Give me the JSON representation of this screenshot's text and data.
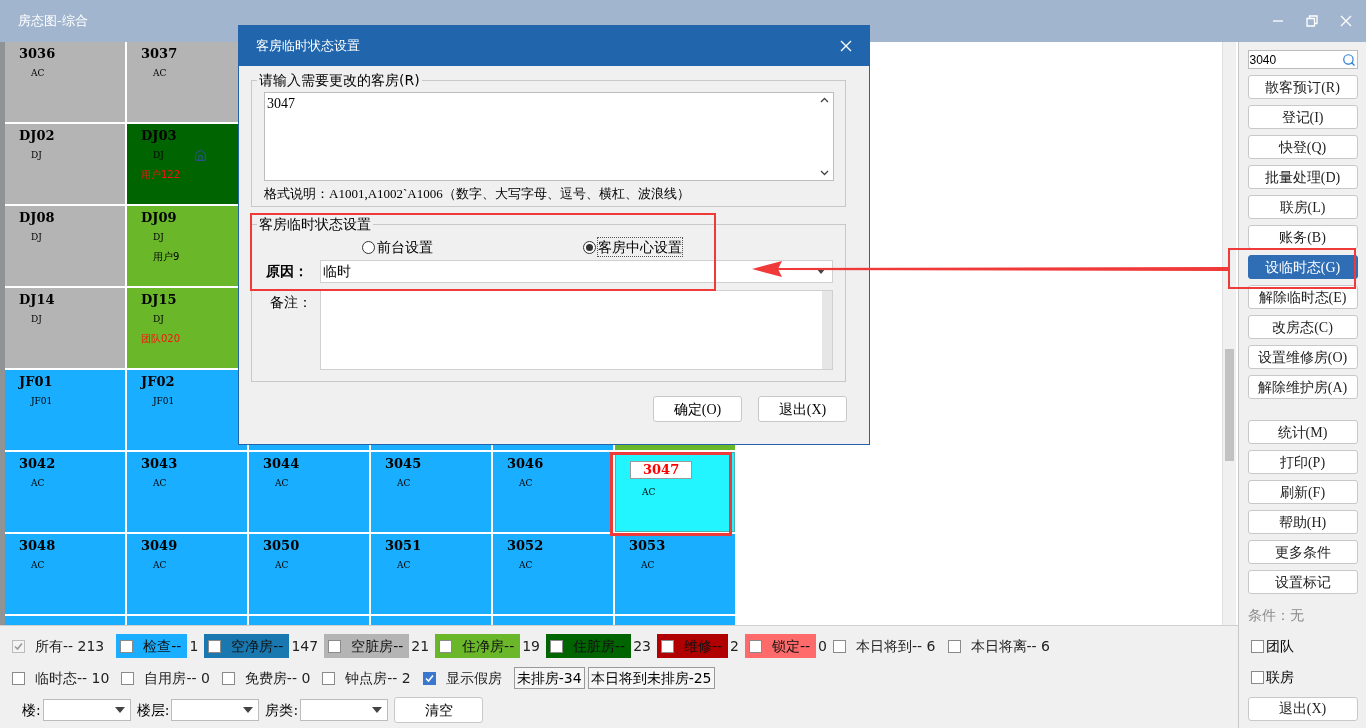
{
  "window": {
    "title": "房态图-综合"
  },
  "rooms": {
    "rows": [
      {
        "cells": [
          {
            "room": "3036",
            "type": "AC",
            "color": "#b4b4b4",
            "selected": false
          },
          {
            "room": "3037",
            "type": "AC",
            "color": "#b4b4b4",
            "selected": false
          }
        ]
      },
      {
        "cells": [
          {
            "room": "DJ02",
            "type": "DJ",
            "color": "#b4b4b4",
            "selected": false
          },
          {
            "room": "DJ03",
            "type": "DJ",
            "color": "#006400",
            "selected": false,
            "guest": "用户122",
            "alert": true,
            "marked": true
          }
        ]
      },
      {
        "cells": [
          {
            "room": "DJ08",
            "type": "DJ",
            "color": "#b4b4b4",
            "selected": false
          },
          {
            "room": "DJ09",
            "type": "DJ",
            "color": "#6ab82a",
            "selected": false,
            "guest": "用户9",
            "alert": false
          }
        ]
      },
      {
        "cells": [
          {
            "room": "DJ14",
            "type": "DJ",
            "color": "#b4b4b4",
            "selected": false
          },
          {
            "room": "DJ15",
            "type": "DJ",
            "color": "#6ab82a",
            "selected": false,
            "guest": "团队020",
            "alert": true
          }
        ]
      },
      {
        "cells": [
          {
            "room": "JF01",
            "type": "JF01",
            "color": "#19aeff",
            "selected": false
          },
          {
            "room": "JF02",
            "type": "JF01",
            "color": "#19aeff",
            "selected": false
          },
          {
            "color": "#19aeff",
            "selected": false
          },
          {
            "color": "#19aeff",
            "selected": false
          },
          {
            "color": "#19aeff",
            "selected": false
          },
          {
            "color": "#6ab82a",
            "selected": false
          }
        ]
      },
      {
        "cells": [
          {
            "room": "3042",
            "type": "AC",
            "color": "#19aeff",
            "selected": false
          },
          {
            "room": "3043",
            "type": "AC",
            "color": "#19aeff",
            "selected": false
          },
          {
            "room": "3044",
            "type": "AC",
            "color": "#19aeff",
            "selected": false
          },
          {
            "room": "3045",
            "type": "AC",
            "color": "#19aeff",
            "selected": false
          },
          {
            "room": "3046",
            "type": "AC",
            "color": "#19aeff",
            "selected": false
          },
          {
            "room": "3047",
            "type": "AC",
            "color": "#22f5ff",
            "selected": true
          }
        ]
      },
      {
        "cells": [
          {
            "room": "3048",
            "type": "AC",
            "color": "#19aeff",
            "selected": false
          },
          {
            "room": "3049",
            "type": "AC",
            "color": "#19aeff",
            "selected": false
          },
          {
            "room": "3050",
            "type": "AC",
            "color": "#19aeff",
            "selected": false
          },
          {
            "room": "3051",
            "type": "AC",
            "color": "#19aeff",
            "selected": false
          },
          {
            "room": "3052",
            "type": "AC",
            "color": "#19aeff",
            "selected": false
          },
          {
            "room": "3053",
            "type": "AC",
            "color": "#19aeff",
            "selected": false
          }
        ]
      },
      {
        "cells": [
          {
            "color": "#19aeff",
            "selected": false
          },
          {
            "color": "#19aeff",
            "selected": false
          },
          {
            "color": "#19aeff",
            "selected": false
          },
          {
            "color": "#19aeff",
            "selected": false
          },
          {
            "color": "#19aeff",
            "selected": false
          },
          {
            "color": "#19aeff",
            "selected": false
          }
        ]
      }
    ]
  },
  "dialog": {
    "title": "客房临时状态设置",
    "rooms_group": {
      "legend": "请输入需要更改的客房(R)",
      "value": "3047",
      "hint": "格式说明：A1001,A1002`A1006（数字、大写字母、逗号、横杠、波浪线）"
    },
    "status_group": {
      "legend": "客房临时状态设置",
      "options": [
        {
          "label": "前台设置",
          "selected": false
        },
        {
          "label": "客房中心设置",
          "selected": true
        }
      ],
      "reason_label": "原因：",
      "reason": "临时",
      "remark_label": "备注："
    },
    "buttons": [
      "确定(O)",
      "退出(X)"
    ]
  },
  "sidebar": {
    "search": "3040",
    "groups": [
      [
        {
          "label": "散客预订(R)",
          "selected": false
        },
        {
          "label": "登记(I)",
          "selected": false
        },
        {
          "label": "快登(Q)",
          "selected": false
        },
        {
          "label": "批量处理(D)",
          "selected": false
        },
        {
          "label": "联房(L)",
          "selected": false
        },
        {
          "label": "账务(B)",
          "selected": false
        },
        {
          "label": "设临时态(G)",
          "selected": true
        },
        {
          "label": "解除临时态(E)",
          "selected": false
        },
        {
          "label": "改房态(C)",
          "selected": false
        },
        {
          "label": "设置维修房(O)",
          "selected": false
        },
        {
          "label": "解除维护房(A)",
          "selected": false
        }
      ],
      [
        {
          "label": "统计(M)",
          "selected": false
        },
        {
          "label": "打印(P)",
          "selected": false
        },
        {
          "label": "刷新(F)",
          "selected": false
        },
        {
          "label": "帮助(H)",
          "selected": false
        },
        {
          "label": "更多条件",
          "selected": false
        },
        {
          "label": "设置标记",
          "selected": false
        }
      ]
    ],
    "condition": "条件：无",
    "filters": [
      {
        "label": "团队",
        "checked": false
      },
      {
        "label": "联房",
        "checked": false
      }
    ],
    "exit": "退出(X)"
  },
  "legend": {
    "rows": [
      [
        {
          "kind": "check",
          "label": "所有--",
          "count": "213",
          "checked": true,
          "disabled": true
        },
        {
          "kind": "swatch",
          "label": "检查--",
          "count": "1",
          "color": "#19aeff",
          "checked": false,
          "disabled": false
        },
        {
          "kind": "swatch",
          "label": "空净房--",
          "count": "147",
          "color": "#1a78b0",
          "checked": false,
          "disabled": false
        },
        {
          "kind": "swatch",
          "label": "空脏房--",
          "count": "21",
          "color": "#b4b4b4",
          "checked": false,
          "disabled": false
        },
        {
          "kind": "swatch",
          "label": "住净房--",
          "count": "19",
          "color": "#6ab82a",
          "checked": false,
          "disabled": false
        },
        {
          "kind": "swatch",
          "label": "住脏房--",
          "count": "23",
          "color": "#006400",
          "checked": false,
          "disabled": false
        },
        {
          "kind": "swatch",
          "label": "维修--",
          "count": "2",
          "color": "#b00000",
          "checked": false,
          "disabled": false
        },
        {
          "kind": "swatch",
          "label": "锁定--",
          "count": "0",
          "color": "#ff6a6a",
          "checked": false,
          "disabled": false
        },
        {
          "kind": "check",
          "label": "本日将到--",
          "count": "6",
          "checked": false,
          "disabled": false
        },
        {
          "kind": "check",
          "label": "本日将离--",
          "count": "6",
          "checked": false,
          "disabled": false
        }
      ],
      [
        {
          "kind": "check",
          "label": "临时态--",
          "count": "10",
          "checked": false,
          "disabled": false
        },
        {
          "kind": "check",
          "label": "自用房--",
          "count": "0",
          "checked": false,
          "disabled": false
        },
        {
          "kind": "check",
          "label": "免费房--",
          "count": "0",
          "checked": false,
          "disabled": false
        },
        {
          "kind": "check",
          "label": "钟点房--",
          "count": "2",
          "checked": false,
          "disabled": false
        },
        {
          "kind": "check",
          "label": "显示假房",
          "checked": true,
          "disabled": false
        },
        {
          "kind": "tag",
          "label": "未排房-34"
        },
        {
          "kind": "tag",
          "label": "本日将到未排房-25"
        }
      ]
    ],
    "selects": [
      {
        "label": "楼:"
      },
      {
        "label": "楼层:"
      },
      {
        "label": "房类:"
      }
    ],
    "clear": "清空"
  }
}
